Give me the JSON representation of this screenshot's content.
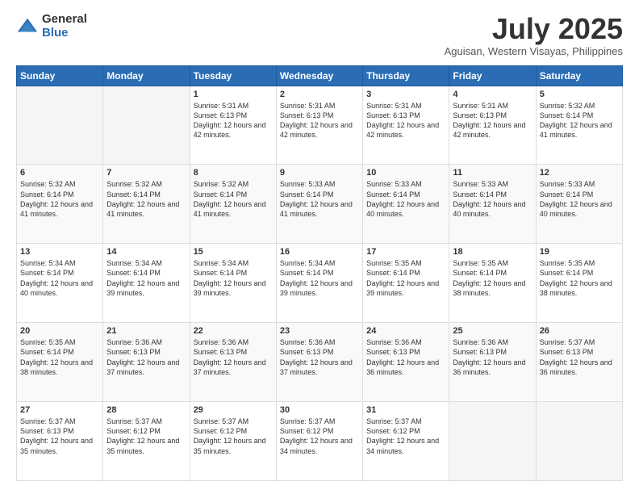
{
  "header": {
    "logo_general": "General",
    "logo_blue": "Blue",
    "month_title": "July 2025",
    "location": "Aguisan, Western Visayas, Philippines"
  },
  "calendar": {
    "days_of_week": [
      "Sunday",
      "Monday",
      "Tuesday",
      "Wednesday",
      "Thursday",
      "Friday",
      "Saturday"
    ],
    "rows": [
      [
        {
          "day": "",
          "empty": true
        },
        {
          "day": "",
          "empty": true
        },
        {
          "day": "1",
          "sunrise": "5:31 AM",
          "sunset": "6:13 PM",
          "daylight": "12 hours and 42 minutes."
        },
        {
          "day": "2",
          "sunrise": "5:31 AM",
          "sunset": "6:13 PM",
          "daylight": "12 hours and 42 minutes."
        },
        {
          "day": "3",
          "sunrise": "5:31 AM",
          "sunset": "6:13 PM",
          "daylight": "12 hours and 42 minutes."
        },
        {
          "day": "4",
          "sunrise": "5:31 AM",
          "sunset": "6:13 PM",
          "daylight": "12 hours and 42 minutes."
        },
        {
          "day": "5",
          "sunrise": "5:32 AM",
          "sunset": "6:14 PM",
          "daylight": "12 hours and 41 minutes."
        }
      ],
      [
        {
          "day": "6",
          "sunrise": "5:32 AM",
          "sunset": "6:14 PM",
          "daylight": "12 hours and 41 minutes."
        },
        {
          "day": "7",
          "sunrise": "5:32 AM",
          "sunset": "6:14 PM",
          "daylight": "12 hours and 41 minutes."
        },
        {
          "day": "8",
          "sunrise": "5:32 AM",
          "sunset": "6:14 PM",
          "daylight": "12 hours and 41 minutes."
        },
        {
          "day": "9",
          "sunrise": "5:33 AM",
          "sunset": "6:14 PM",
          "daylight": "12 hours and 41 minutes."
        },
        {
          "day": "10",
          "sunrise": "5:33 AM",
          "sunset": "6:14 PM",
          "daylight": "12 hours and 40 minutes."
        },
        {
          "day": "11",
          "sunrise": "5:33 AM",
          "sunset": "6:14 PM",
          "daylight": "12 hours and 40 minutes."
        },
        {
          "day": "12",
          "sunrise": "5:33 AM",
          "sunset": "6:14 PM",
          "daylight": "12 hours and 40 minutes."
        }
      ],
      [
        {
          "day": "13",
          "sunrise": "5:34 AM",
          "sunset": "6:14 PM",
          "daylight": "12 hours and 40 minutes."
        },
        {
          "day": "14",
          "sunrise": "5:34 AM",
          "sunset": "6:14 PM",
          "daylight": "12 hours and 39 minutes."
        },
        {
          "day": "15",
          "sunrise": "5:34 AM",
          "sunset": "6:14 PM",
          "daylight": "12 hours and 39 minutes."
        },
        {
          "day": "16",
          "sunrise": "5:34 AM",
          "sunset": "6:14 PM",
          "daylight": "12 hours and 39 minutes."
        },
        {
          "day": "17",
          "sunrise": "5:35 AM",
          "sunset": "6:14 PM",
          "daylight": "12 hours and 39 minutes."
        },
        {
          "day": "18",
          "sunrise": "5:35 AM",
          "sunset": "6:14 PM",
          "daylight": "12 hours and 38 minutes."
        },
        {
          "day": "19",
          "sunrise": "5:35 AM",
          "sunset": "6:14 PM",
          "daylight": "12 hours and 38 minutes."
        }
      ],
      [
        {
          "day": "20",
          "sunrise": "5:35 AM",
          "sunset": "6:14 PM",
          "daylight": "12 hours and 38 minutes."
        },
        {
          "day": "21",
          "sunrise": "5:36 AM",
          "sunset": "6:13 PM",
          "daylight": "12 hours and 37 minutes."
        },
        {
          "day": "22",
          "sunrise": "5:36 AM",
          "sunset": "6:13 PM",
          "daylight": "12 hours and 37 minutes."
        },
        {
          "day": "23",
          "sunrise": "5:36 AM",
          "sunset": "6:13 PM",
          "daylight": "12 hours and 37 minutes."
        },
        {
          "day": "24",
          "sunrise": "5:36 AM",
          "sunset": "6:13 PM",
          "daylight": "12 hours and 36 minutes."
        },
        {
          "day": "25",
          "sunrise": "5:36 AM",
          "sunset": "6:13 PM",
          "daylight": "12 hours and 36 minutes."
        },
        {
          "day": "26",
          "sunrise": "5:37 AM",
          "sunset": "6:13 PM",
          "daylight": "12 hours and 36 minutes."
        }
      ],
      [
        {
          "day": "27",
          "sunrise": "5:37 AM",
          "sunset": "6:13 PM",
          "daylight": "12 hours and 35 minutes."
        },
        {
          "day": "28",
          "sunrise": "5:37 AM",
          "sunset": "6:12 PM",
          "daylight": "12 hours and 35 minutes."
        },
        {
          "day": "29",
          "sunrise": "5:37 AM",
          "sunset": "6:12 PM",
          "daylight": "12 hours and 35 minutes."
        },
        {
          "day": "30",
          "sunrise": "5:37 AM",
          "sunset": "6:12 PM",
          "daylight": "12 hours and 34 minutes."
        },
        {
          "day": "31",
          "sunrise": "5:37 AM",
          "sunset": "6:12 PM",
          "daylight": "12 hours and 34 minutes."
        },
        {
          "day": "",
          "empty": true
        },
        {
          "day": "",
          "empty": true
        }
      ]
    ]
  }
}
